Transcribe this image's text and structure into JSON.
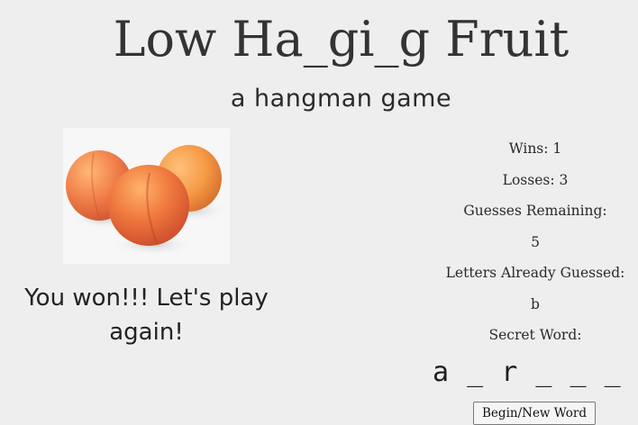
{
  "header": {
    "title": "Low Ha_gi_g Fruit",
    "subtitle": "a hangman game"
  },
  "image": {
    "icon": "apricots-image"
  },
  "message": "You won!!! Let's play again!",
  "stats": {
    "wins_label": "Wins: 1",
    "losses_label": "Losses: 3",
    "guesses_remaining_label": "Guesses Remaining:",
    "guesses_remaining_value": "5",
    "letters_guessed_label": "Letters Already Guessed:",
    "letters_guessed_value": "b",
    "secret_word_label": "Secret Word:"
  },
  "secret_word": "a _ r _ _ _ t",
  "controls": {
    "new_word_button": "Begin/New Word"
  },
  "colors": {
    "background": "#eeeeee",
    "text": "#2b2b2b",
    "fruit": "#f0874d"
  }
}
